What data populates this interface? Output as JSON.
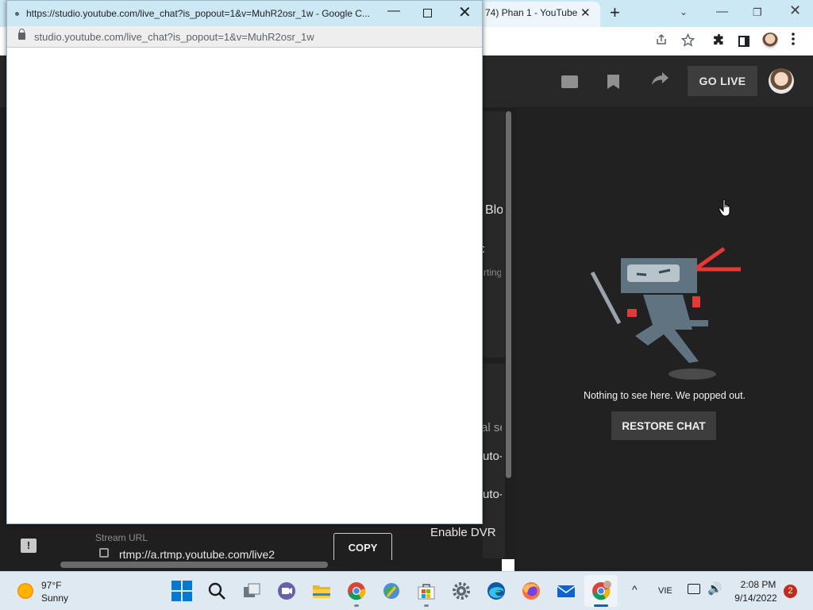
{
  "background_tab": {
    "title": "74) Phan 1 - YouTube",
    "close": "✕",
    "new_tab": "+"
  },
  "background_window_controls": {
    "tab_search": "⌄",
    "minimize": "—",
    "restore": "❐",
    "close": "✕"
  },
  "studio": {
    "go_live": "GO LIVE",
    "clipped_texts": [
      "Blo",
      "c",
      "rting",
      "al se",
      "uto-",
      "uto-"
    ],
    "enable_dvr": "Enable DVR",
    "stream_url_label": "Stream URL",
    "stream_url_value": "rtmp://a.rtmp.youtube.com/live2",
    "copy_label": "COPY",
    "feedback_glyph": "!"
  },
  "chat": {
    "message": "Nothing to see here. We popped out.",
    "restore_label": "RESTORE CHAT",
    "accent_color": "#e53935"
  },
  "popup": {
    "title": "https://studio.youtube.com/live_chat?is_popout=1&v=MuhR2osr_1w - Google C...",
    "url": "studio.youtube.com/live_chat?is_popout=1&v=MuhR2osr_1w",
    "minimize": "—",
    "close": "✕"
  },
  "taskbar": {
    "weather_temp": "97°F",
    "weather_desc": "Sunny",
    "apps": [
      "start",
      "search",
      "task-view",
      "teams",
      "file-explorer",
      "chrome",
      "internet-explorer",
      "microsoft-store",
      "settings",
      "edge",
      "firefox",
      "mail",
      "chrome"
    ],
    "tray_chevron": "^",
    "language": "VIE",
    "volume_glyph": "🔊",
    "time": "2:08 PM",
    "date": "9/14/2022",
    "notifications": "2"
  }
}
